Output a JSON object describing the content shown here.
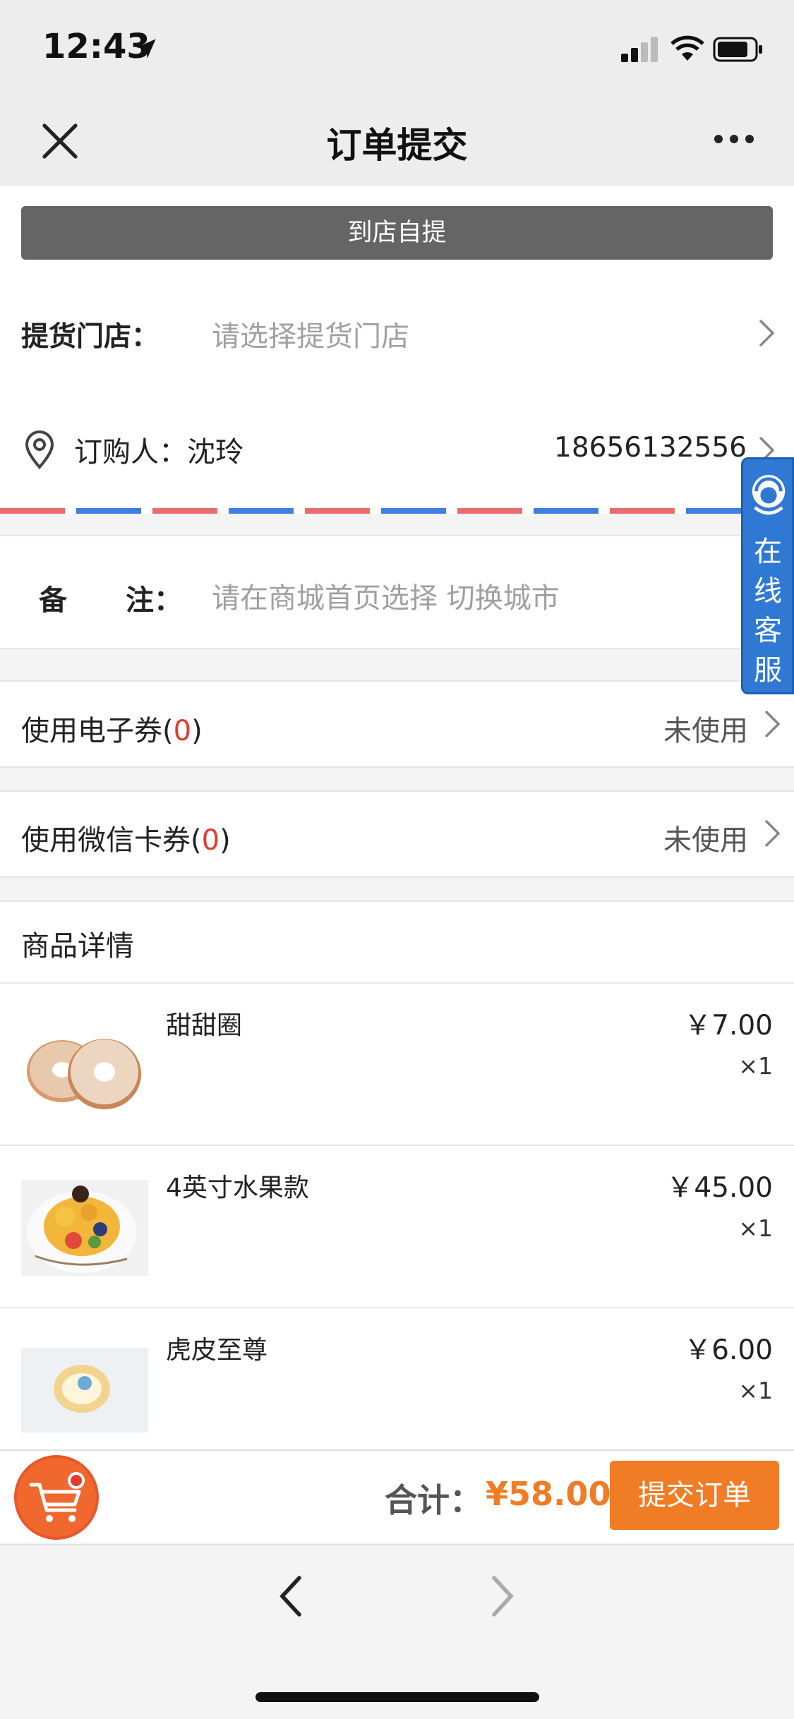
{
  "status_bar": {
    "time": "12:43"
  },
  "nav": {
    "title": "订单提交"
  },
  "pickup": {
    "mode_label": "到店自提"
  },
  "store": {
    "label": "提货门店：",
    "placeholder": "请选择提货门店"
  },
  "buyer": {
    "label": "订购人：沈玲",
    "phone": "18656132556"
  },
  "note": {
    "label_part1": "备",
    "label_part2": "注：",
    "placeholder": "请在商城首页选择 切换城市"
  },
  "coupons": [
    {
      "label": "使用电子券(",
      "count": "0",
      "suffix": ")",
      "state": "未使用"
    },
    {
      "label": "使用微信卡券(",
      "count": "0",
      "suffix": ")",
      "state": "未使用"
    }
  ],
  "goods": {
    "title": "商品详情",
    "items": [
      {
        "name": "甜甜圈",
        "price": "￥7.00",
        "qty": "×1"
      },
      {
        "name": "4英寸水果款",
        "price": "￥45.00",
        "qty": "×1"
      },
      {
        "name": "虎皮至尊",
        "price": "￥6.00",
        "qty": "×1"
      }
    ]
  },
  "footer": {
    "total_label": "合计：",
    "total_value": "¥58.00",
    "submit_label": "提交订单"
  },
  "customer_service": {
    "label": "在线客服"
  },
  "colors": {
    "accent": "#f07c26",
    "red": "#e33a2e",
    "cs_blue": "#2f79d4"
  }
}
